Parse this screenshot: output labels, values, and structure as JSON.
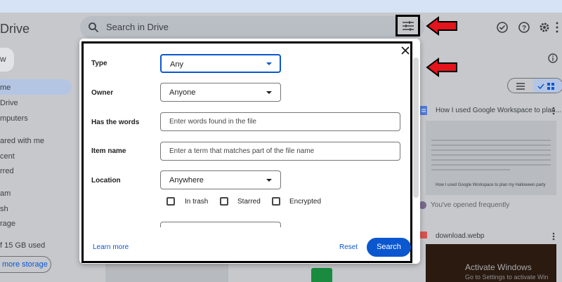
{
  "header": {
    "app_name": "Drive",
    "search_placeholder": "Search in Drive"
  },
  "sidebar": {
    "new_label": "w",
    "items": [
      {
        "label": "me"
      },
      {
        "label": "Drive"
      },
      {
        "label": "mputers"
      },
      {
        "label": "ared with me"
      },
      {
        "label": "cent"
      },
      {
        "label": "rred"
      },
      {
        "label": "am"
      },
      {
        "label": "sh"
      },
      {
        "label": "rage"
      }
    ],
    "storage_used": "f 15 GB used",
    "storage_button": "more storage"
  },
  "right_panel": {
    "doc_title": "How I used Google Workspace to plan...",
    "doc_caption": "How I used Google Workspace to plan my Halloween party",
    "opened_text": "You've opened frequently",
    "file2_title": "download.webp",
    "watermark_line1": "Activate Windows",
    "watermark_line2": "Go to Settings to activate Win"
  },
  "dialog": {
    "type": {
      "label": "Type",
      "value": "Any"
    },
    "owner": {
      "label": "Owner",
      "value": "Anyone"
    },
    "has_words": {
      "label": "Has the words",
      "placeholder": "Enter words found in the file"
    },
    "item_name": {
      "label": "Item name",
      "placeholder": "Enter a term that matches part of the file name"
    },
    "location": {
      "label": "Location",
      "value": "Anywhere"
    },
    "checkboxes": [
      {
        "label": "In trash"
      },
      {
        "label": "Starred"
      },
      {
        "label": "Encrypted"
      }
    ],
    "learn_more": "Learn more",
    "reset": "Reset",
    "search": "Search"
  },
  "colors": {
    "accent": "#0b57d0",
    "arrow": "#e3141b"
  }
}
